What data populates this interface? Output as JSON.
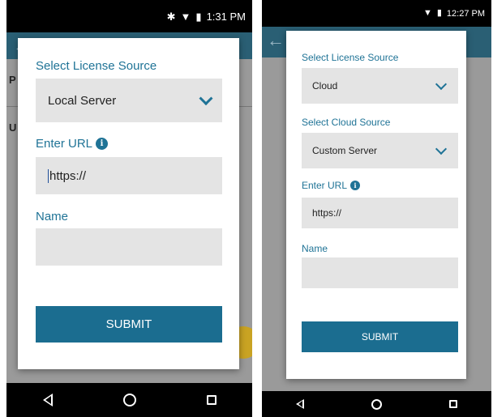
{
  "screens": [
    {
      "status_time": "1:31 PM",
      "status_icons": [
        "bluetooth-icon",
        "wifi-icon",
        "battery-icon"
      ],
      "background_rows": [
        "P",
        "U"
      ],
      "dialog": {
        "license_source_label": "Select License Source",
        "license_source_value": "Local Server",
        "url_label": "Enter URL",
        "url_value": "https://",
        "name_label": "Name",
        "name_value": "",
        "submit_label": "SUBMIT"
      }
    },
    {
      "status_time": "12:27 PM",
      "status_icons": [
        "wifi-icon",
        "battery-icon"
      ],
      "dialog": {
        "license_source_label": "Select License Source",
        "license_source_value": "Cloud",
        "cloud_source_label": "Select Cloud Source",
        "cloud_source_value": "Custom Server",
        "url_label": "Enter URL",
        "url_value": "https://",
        "name_label": "Name",
        "name_value": "",
        "submit_label": "SUBMIT"
      }
    }
  ],
  "colors": {
    "accent": "#1f7396",
    "submit_bg": "#1b6d90",
    "app_bar": "#2a5f74",
    "field_bg": "#e4e4e4",
    "fab": "#c9a323"
  }
}
